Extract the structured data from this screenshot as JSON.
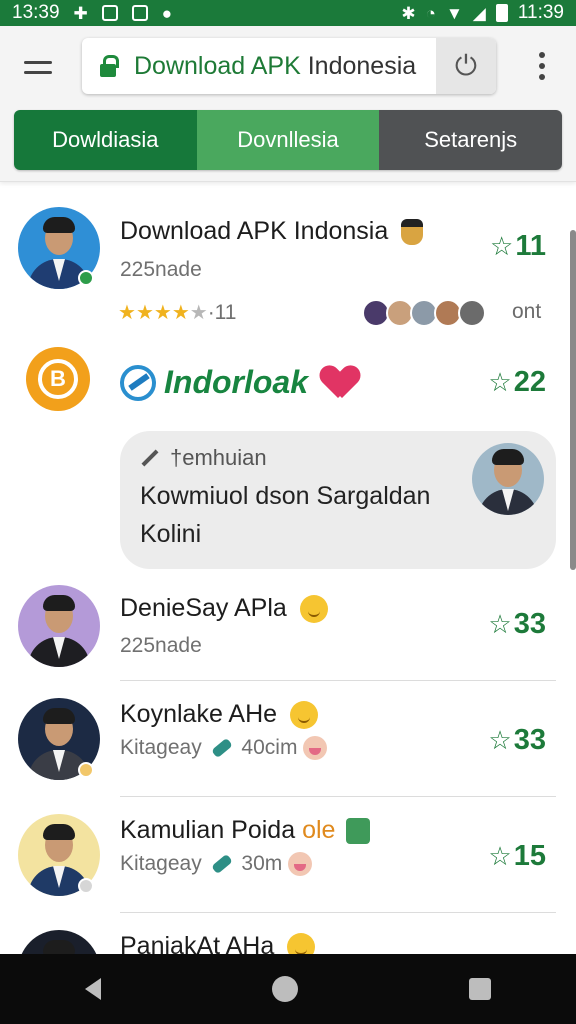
{
  "status_bar": {
    "time_left": "13:39",
    "time_right": "11:39"
  },
  "browser": {
    "url_accent": "Download APK",
    "url_rest": "Indonesia"
  },
  "tabs": [
    {
      "label": "Dowldiasia"
    },
    {
      "label": "Dovnllesia"
    },
    {
      "label": "Setarenjs"
    }
  ],
  "list": [
    {
      "name": "Download APK Indonsia",
      "sub": "225nade",
      "rating": "11",
      "stars_text": "·11",
      "stars_filled": 4,
      "extra_label": "ont"
    },
    {
      "brand_name": "Indorloak",
      "rating": "22",
      "message_label": "†emhuian",
      "message_body": "Kowmiuol dson Sargaldan Kolini"
    },
    {
      "name": "DenieSay APla",
      "sub": "225nade",
      "rating": "33"
    },
    {
      "name": "Koynlake AHe",
      "sub_a": "Kitageay",
      "sub_b": "40cim",
      "rating": "33"
    },
    {
      "name": "Kamulian Poida",
      "name_accent": "ole",
      "sub_a": "Kitageay",
      "sub_b": "30m",
      "rating": "15"
    },
    {
      "name": "PaniakAt AHa"
    }
  ],
  "colors": {
    "brand_green": "#1b7a3a",
    "tab_mid": "#4aa85e",
    "tab_dark": "#505254",
    "star_gold": "#f0b21e"
  }
}
